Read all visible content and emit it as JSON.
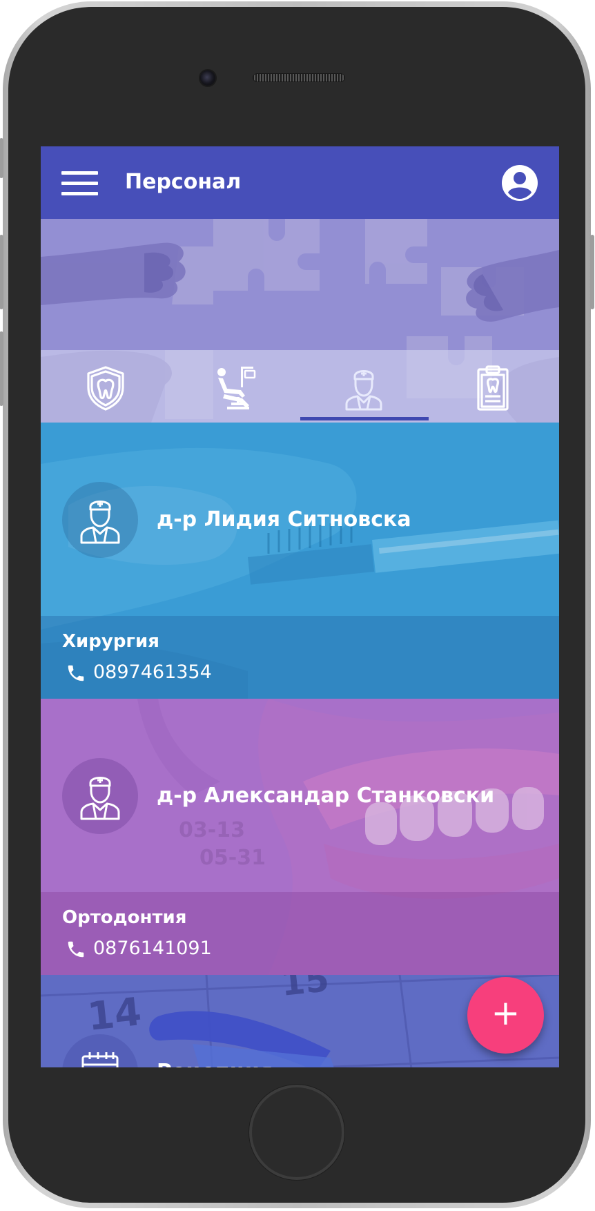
{
  "app_bar": {
    "title": "Персонал"
  },
  "tabs": [
    {
      "name": "tooth-shield-icon",
      "active": false
    },
    {
      "name": "dental-chair-icon",
      "active": false
    },
    {
      "name": "doctor-icon",
      "active": true
    },
    {
      "name": "dental-clipboard-icon",
      "active": false
    }
  ],
  "staff": [
    {
      "name": "д-р Лидия Ситновска",
      "department": "Хирургия",
      "phone": "0897461354",
      "color": "#3a9fd6",
      "icon": "doctor-icon"
    },
    {
      "name": "д-р Александар Станковски",
      "department": "Ортодонтия",
      "phone": "0876141091",
      "color": "#a86ec9",
      "icon": "doctor-icon"
    },
    {
      "name": "Рецепция",
      "color": "#5f6cc4",
      "icon": "calendar-icon"
    }
  ],
  "fab": {
    "label": "+"
  },
  "colors": {
    "primary": "#474fb9",
    "accent": "#f73f7c"
  }
}
